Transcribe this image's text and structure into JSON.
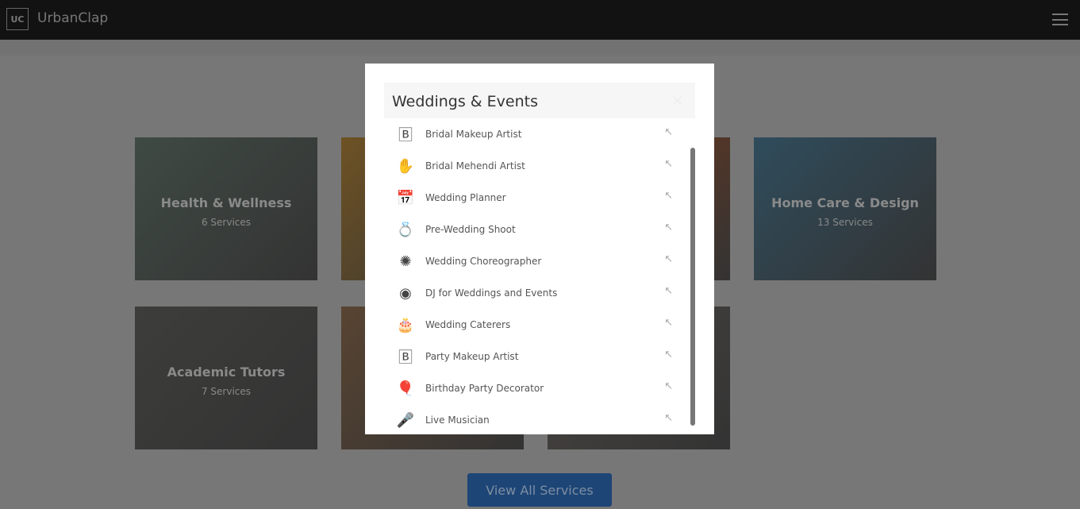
{
  "header": {
    "logo": "UC",
    "brand": "UrbanClap"
  },
  "cards": [
    {
      "title": "Health & Wellness",
      "subtitle": "6 Services",
      "color": "#3f4a44"
    },
    {
      "title": "",
      "subtitle": "",
      "color": "#6e5224"
    },
    {
      "title": "",
      "subtitle": "",
      "color": "#74391a"
    },
    {
      "title": "Home Care & Design",
      "subtitle": "13 Services",
      "color": "#2f4c5c"
    },
    {
      "title": "Academic Tutors",
      "subtitle": "7 Services",
      "color": "#3d3d3b"
    },
    {
      "title": "",
      "subtitle": "",
      "color": "#584432"
    },
    {
      "title": "",
      "subtitle": "",
      "color": "#4a4642"
    }
  ],
  "view_all": "View All Services",
  "modal": {
    "title": "Weddings & Events",
    "close": "×",
    "items": [
      {
        "label": "Bridal Makeup Artist",
        "icon": "lipstick-icon",
        "glyph": "🄱"
      },
      {
        "label": "Bridal Mehendi Artist",
        "icon": "hand-icon",
        "glyph": "✋"
      },
      {
        "label": "Wedding Planner",
        "icon": "calendar-icon",
        "glyph": "📅"
      },
      {
        "label": "Pre-Wedding Shoot",
        "icon": "ring-icon",
        "glyph": "💍"
      },
      {
        "label": "Wedding Choreographer",
        "icon": "disco-ball-icon",
        "glyph": "✺"
      },
      {
        "label": "DJ for Weddings and Events",
        "icon": "turntable-icon",
        "glyph": "◉"
      },
      {
        "label": "Wedding Caterers",
        "icon": "cake-icon",
        "glyph": "🎂"
      },
      {
        "label": "Party Makeup Artist",
        "icon": "lipstick-icon",
        "glyph": "🄱"
      },
      {
        "label": "Birthday Party Decorator",
        "icon": "balloon-icon",
        "glyph": "🎈"
      },
      {
        "label": "Live Musician",
        "icon": "microphone-icon",
        "glyph": "🎤"
      }
    ],
    "arrow": "↖"
  }
}
